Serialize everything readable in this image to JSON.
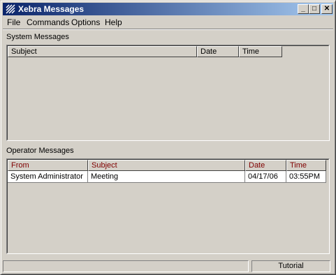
{
  "window": {
    "title": "Xebra Messages",
    "icon": "xebra-logo-icon"
  },
  "title_buttons": {
    "minimize": "_",
    "maximize": "□",
    "close": "✕"
  },
  "menu": [
    "File",
    "Commands",
    "Options",
    "Help"
  ],
  "system_messages": {
    "label": "System Messages",
    "columns": [
      "Subject",
      "Date",
      "Time"
    ],
    "rows": []
  },
  "operator_messages": {
    "label": "Operator Messages",
    "columns": [
      "From",
      "Subject",
      "Date",
      "Time"
    ],
    "rows": [
      {
        "from": "System Administrator",
        "subject": "Meeting",
        "date": "04/17/06",
        "time": "03:55PM"
      }
    ]
  },
  "status": {
    "panel_text": "Tutorial"
  },
  "colors": {
    "title_start": "#0a246a",
    "title_end": "#a6caf0",
    "header_text_operator": "#800000",
    "face": "#d4d0c8"
  }
}
